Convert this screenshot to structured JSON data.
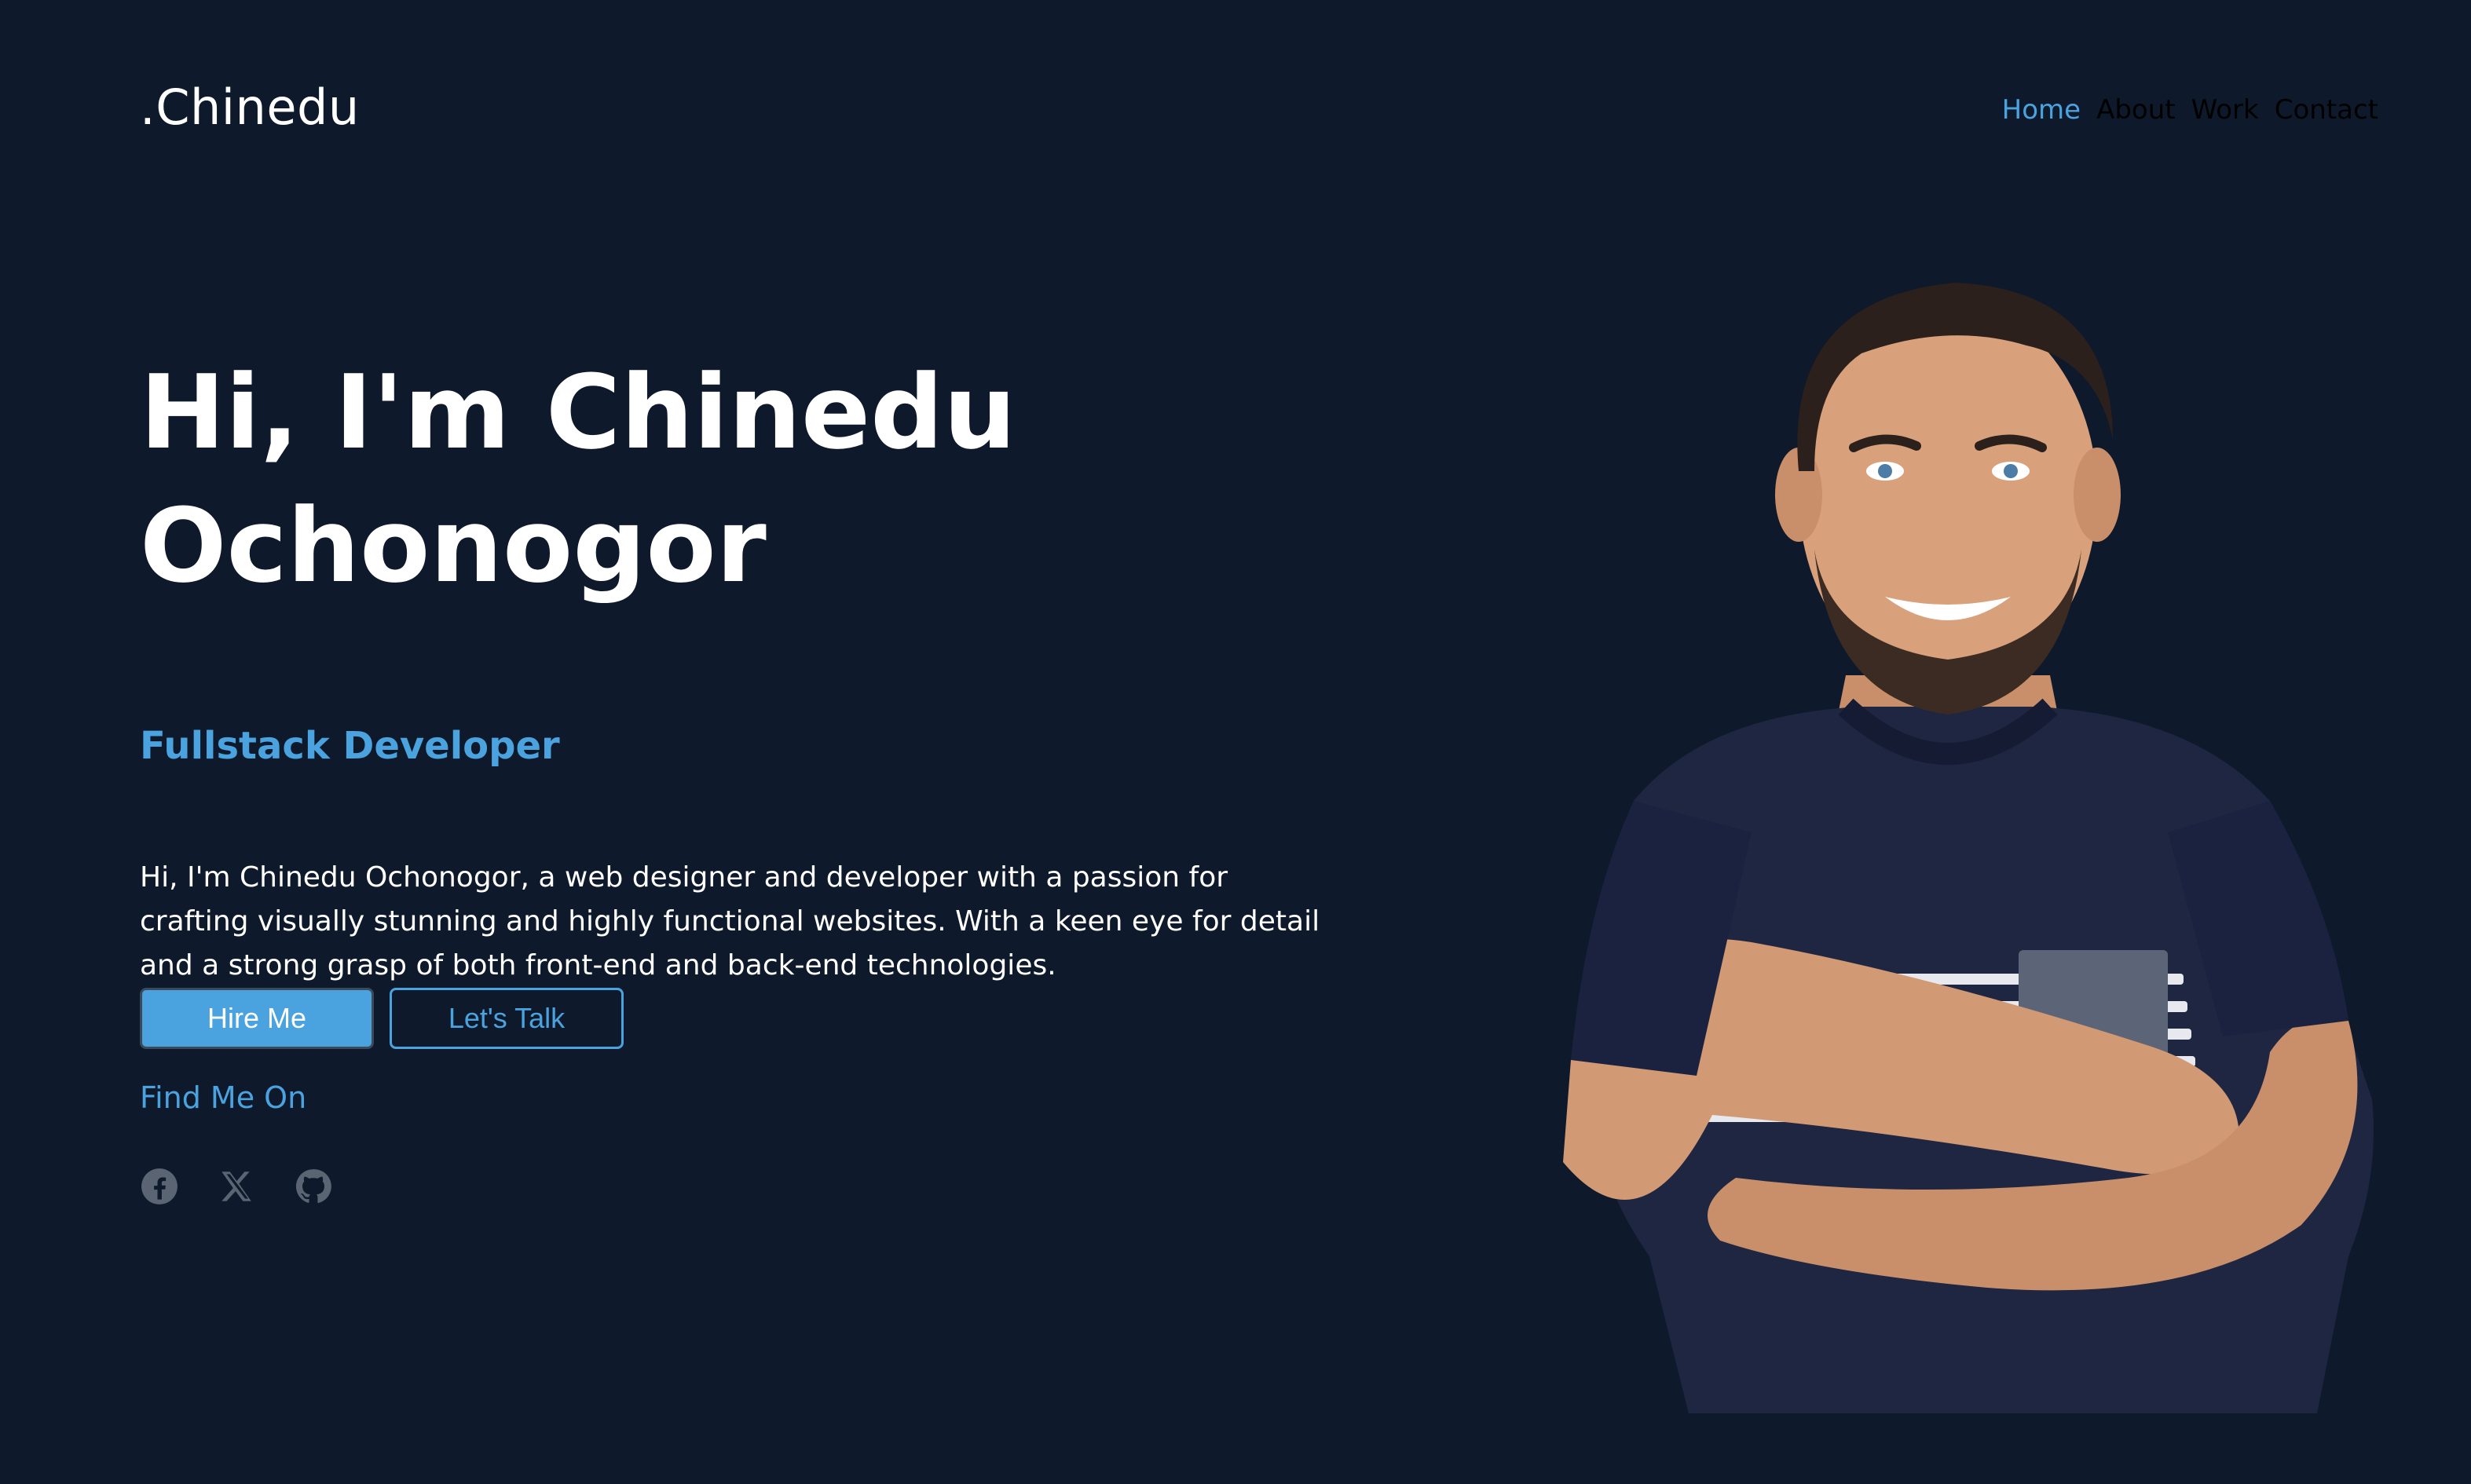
{
  "brand": ".Chinedu",
  "nav": {
    "home": "Home",
    "about": "About",
    "work": "Work",
    "contact": "Contact"
  },
  "hero": {
    "title_line1": "Hi, I'm Chinedu",
    "title_line2": "Ochonogor",
    "role": "Fullstack Developer",
    "description": "Hi, I'm Chinedu Ochonogor, a web designer and developer with a passion for crafting visually stunning and highly functional websites. With a keen eye for detail and a strong grasp of both front-end and back-end technologies.",
    "hire_label": "Hire Me",
    "talk_label": "Let's Talk",
    "find_label": "Find Me On"
  },
  "socials": {
    "icons": [
      "facebook-icon",
      "x-icon",
      "github-icon"
    ]
  },
  "colors": {
    "background": "#0e1a2b",
    "accent": "#4aa3df",
    "text": "#ffffff"
  }
}
